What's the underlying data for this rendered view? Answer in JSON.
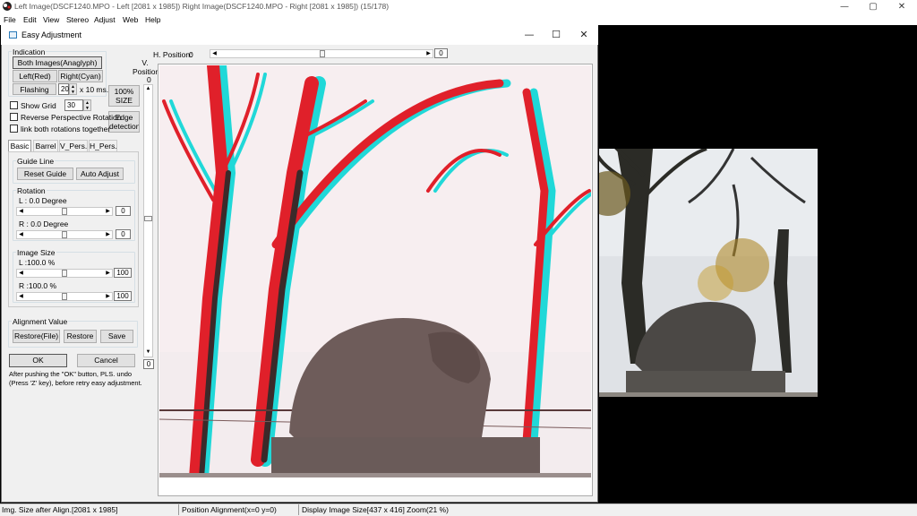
{
  "window": {
    "title": "Left Image(DSCF1240.MPO - Left [2081 x 1985]) Right Image(DSCF1240.MPO - Right [2081 x 1985])  (15/178)",
    "minimize": "—",
    "maximize": "▢",
    "close": "✕"
  },
  "menu": [
    "File",
    "Edit",
    "View",
    "Stereo",
    "Adjust",
    "Web",
    "Help"
  ],
  "dialog": {
    "title": "Easy Adjustment",
    "minimize": "—",
    "maximize": "☐",
    "close": "✕",
    "indication": {
      "label": "Indication",
      "both_button": "Both Images(Anaglyph)",
      "left_button": "Left(Red)",
      "right_button": "Right(Cyan)",
      "flashing_button": "Flashing",
      "flashing_value": "20",
      "flashing_unit": "x 10 ms."
    },
    "size_button": "100% SIZE",
    "edge_button": "Edge detection",
    "show_grid": {
      "label": "Show Grid",
      "value": "30",
      "checked": false
    },
    "reverse_rotation": {
      "label": "Reverse Perspective Rotation",
      "checked": false
    },
    "link_rotations": {
      "label": "link both rotations together",
      "checked": false
    },
    "tabs": [
      "Basic",
      "Barrel",
      "V_Pers.",
      "H_Pers."
    ],
    "active_tab": "Basic",
    "guide_line": {
      "label": "Guide Line",
      "reset_button": "Reset Guide",
      "auto_button": "Auto Adjust"
    },
    "rotation": {
      "label": "Rotation",
      "left_label": "L : 0.0 Degree",
      "left_value": "0",
      "right_label": "R : 0.0 Degree",
      "right_value": "0"
    },
    "image_size": {
      "label": "Image Size",
      "left_label": "L :100.0 %",
      "left_value": "100",
      "right_label": "R :100.0 %",
      "right_value": "100"
    },
    "alignment": {
      "label": "Alignment Value",
      "restore_file_button": "Restore(File)",
      "restore_button": "Restore",
      "save_button": "Save"
    },
    "ok_button": "OK",
    "cancel_button": "Cancel",
    "note": "After pushing the \"OK\" button, PLS. undo (Press 'Z' key), before retry easy adjustment.",
    "h_position": {
      "label": "H. Position:",
      "value": "0",
      "box_value": "0",
      "level": 0.5
    },
    "v_position": {
      "label": "V. Position",
      "value": "0",
      "box_value": "0",
      "level": 0.5
    }
  },
  "status": [
    "Img. Size after Align.[2081 x 1985]",
    "Position Alignment(x=0 y=0)",
    "Display Image Size[437 x 416]  Zoom(21 %)"
  ],
  "colors": {
    "accent": "#0078d7",
    "anaglyph_red": "#e0202a",
    "anaglyph_cyan": "#20d8d8"
  }
}
